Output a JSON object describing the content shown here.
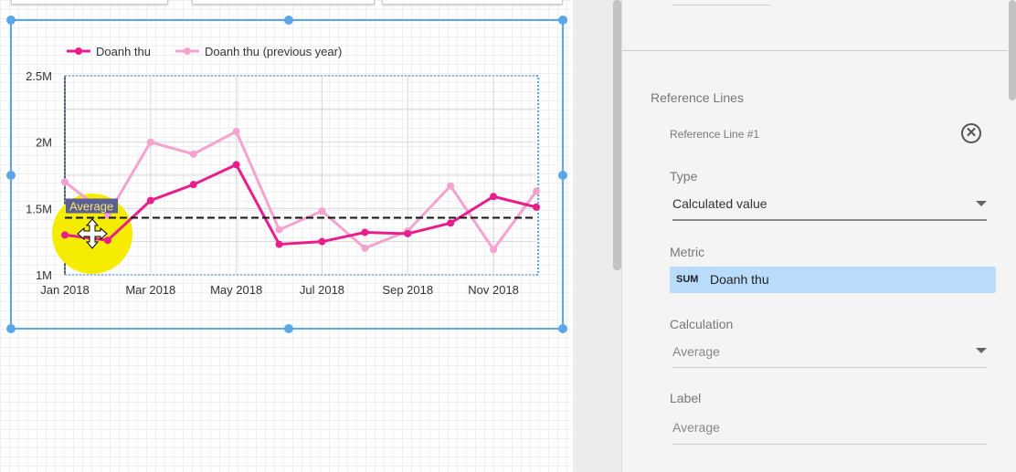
{
  "chart_data": {
    "type": "line",
    "categories": [
      "Jan 2018",
      "Feb 2018",
      "Mar 2018",
      "Apr 2018",
      "May 2018",
      "Jun 2018",
      "Jul 2018",
      "Aug 2018",
      "Sep 2018",
      "Oct 2018",
      "Nov 2018",
      "Dec 2018"
    ],
    "x_tick_labels": [
      "Jan 2018",
      "Mar 2018",
      "May 2018",
      "Jul 2018",
      "Sep 2018",
      "Nov 2018"
    ],
    "y_tick_labels": [
      "1M",
      "1.5M",
      "2M",
      "2.5M"
    ],
    "ylim": [
      1000000,
      2500000
    ],
    "series": [
      {
        "name": "Doanh thu",
        "color": "#e91e8c",
        "values": [
          1300000,
          1260000,
          1560000,
          1680000,
          1830000,
          1230000,
          1250000,
          1320000,
          1310000,
          1390000,
          1590000,
          1510000
        ]
      },
      {
        "name": "Doanh thu (previous year)",
        "color": "#f4a3cf",
        "values": [
          1700000,
          1450000,
          2000000,
          1910000,
          2080000,
          1340000,
          1480000,
          1200000,
          1330000,
          1670000,
          1190000,
          1630000
        ]
      }
    ],
    "reference_line": {
      "label": "Average",
      "value": 1430000
    },
    "legend": "top-left",
    "grid": true
  },
  "panel": {
    "section_title": "Reference Lines",
    "ref_title": "Reference Line #1",
    "type_label": "Type",
    "type_value": "Calculated value",
    "metric_label": "Metric",
    "metric_agg": "SUM",
    "metric_name": "Doanh thu",
    "calc_label": "Calculation",
    "calc_value": "Average",
    "label_label": "Label",
    "label_value": "Average"
  }
}
